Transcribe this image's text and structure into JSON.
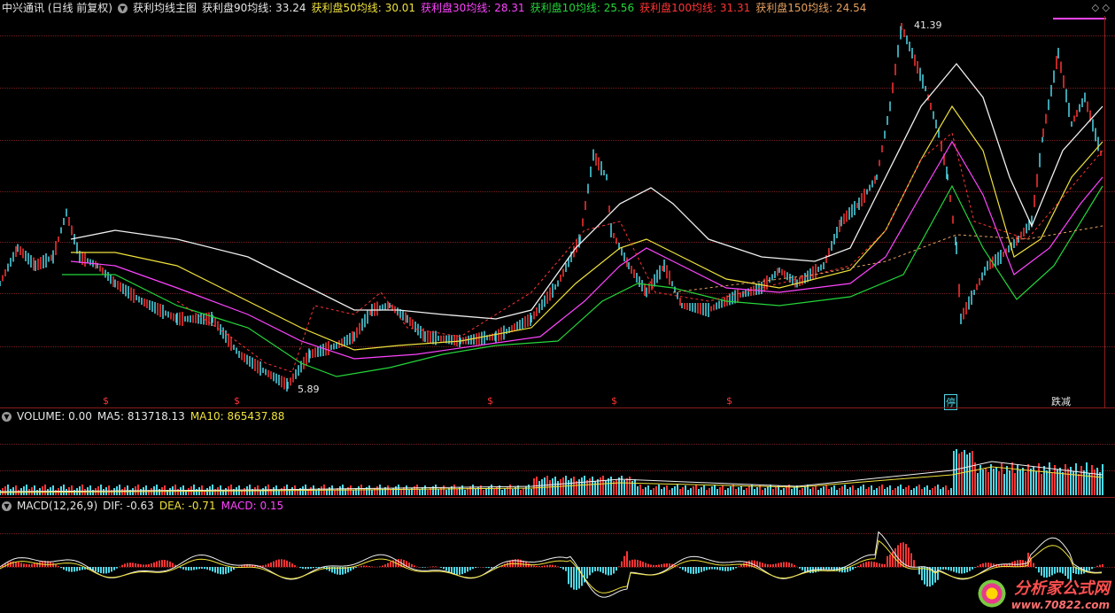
{
  "main": {
    "title": "中兴通讯 (日线 前复权)",
    "indicator_name": "获利均线主图",
    "lines": [
      {
        "label": "获利盘90均线:",
        "value": "33.24",
        "color": "#f0f0f0"
      },
      {
        "label": "获利盘50均线:",
        "value": "30.01",
        "color": "#f0e23c"
      },
      {
        "label": "获利盘30均线:",
        "value": "28.31",
        "color": "#ff44ff"
      },
      {
        "label": "获利盘10均线:",
        "value": "25.56",
        "color": "#24d63a"
      },
      {
        "label": "获利盘100均线:",
        "value": "31.31",
        "color": "#ff3434"
      },
      {
        "label": "获利盘150均线:",
        "value": "24.54",
        "color": "#e6a060"
      }
    ],
    "high_label": "41.39",
    "low_label": "5.89",
    "markers": [
      "$",
      "$",
      "$",
      "$",
      "$"
    ],
    "tag_ting": "停",
    "tag_zhidie": "跌减",
    "tag_zhidie_pre": "",
    "controls": "◇ ◇"
  },
  "volume": {
    "label": "VOLUME:",
    "value": "0.00",
    "ma5_label": "MA5:",
    "ma5_value": "813718.13",
    "ma10_label": "MA10:",
    "ma10_value": "865437.88"
  },
  "macd": {
    "label": "MACD(12,26,9)",
    "dif_label": "DIF:",
    "dif_value": "-0.63",
    "dea_label": "DEA:",
    "dea_value": "-0.71",
    "macd_label": "MACD:",
    "macd_value": "0.15"
  },
  "watermark": {
    "brand": "分析家公式网",
    "url": "www.70822.com"
  },
  "colors": {
    "up": "#ff3434",
    "down": "#4fd8e8",
    "grid": "#7a1e1e",
    "bg": "#000000"
  }
}
